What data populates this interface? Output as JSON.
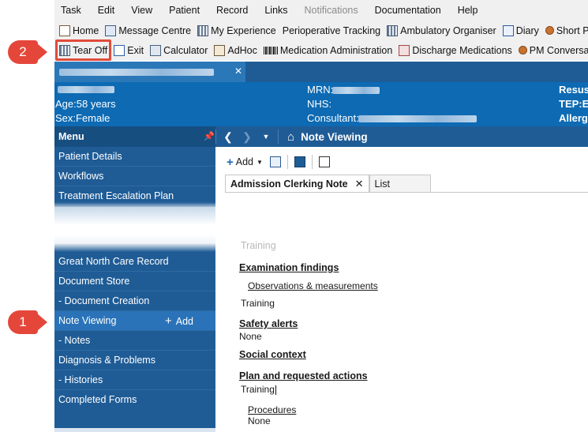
{
  "menubar": {
    "items": [
      "Task",
      "Edit",
      "View",
      "Patient",
      "Record",
      "Links",
      "Notifications",
      "Documentation",
      "Help"
    ],
    "disabled": "Notifications"
  },
  "toolbar1": {
    "home": "Home",
    "message_centre": "Message Centre",
    "my_experience": "My Experience",
    "perioperative": "Perioperative Tracking",
    "ambulatory": "Ambulatory Organiser",
    "diary": "Diary",
    "short_patient": "Short Patien"
  },
  "toolbar2": {
    "tear_off": "Tear Off",
    "exit": "Exit",
    "calculator": "Calculator",
    "adhoc": "AdHoc",
    "medication_admin": "Medication Administration",
    "discharge_meds": "Discharge Medications",
    "pm_conversation": "PM Conversatio"
  },
  "banner": {
    "age": "Age:58 years",
    "sex": "Sex:Female",
    "mrn_label": "MRN:",
    "nhs_label": "NHS:",
    "consultant_label": "Consultant:",
    "resus": "Resus:",
    "tep": "TEP:E",
    "allergies": "Allerg"
  },
  "menu": {
    "header": "Menu",
    "items": [
      "Patient Details",
      "Workflows",
      "Treatment Escalation Plan",
      "Great North Care Record",
      "Document Store",
      "- Document Creation",
      "Note Viewing",
      "- Notes",
      "Diagnosis & Problems",
      "- Histories",
      "Completed Forms"
    ],
    "add_label": "Add"
  },
  "content": {
    "title": "Note Viewing",
    "add_label": "Add",
    "tabs": [
      "Admission Clerking Note",
      "List"
    ],
    "ghost_text": "Training",
    "examination_heading": "Examination findings",
    "observations_link": "Observations & measurements",
    "training_1": "Training",
    "safety_heading": "Safety alerts",
    "none_1": "None",
    "social_heading": "Social context",
    "plan_heading": "Plan and requested actions",
    "training_2": "Training",
    "procedures_link": "Procedures",
    "none_2": "None"
  },
  "callouts": {
    "one": "1",
    "two": "2"
  },
  "colors": {
    "navy": "#1f5c96",
    "banner": "#0d6ab3",
    "callout": "#e4473a"
  }
}
